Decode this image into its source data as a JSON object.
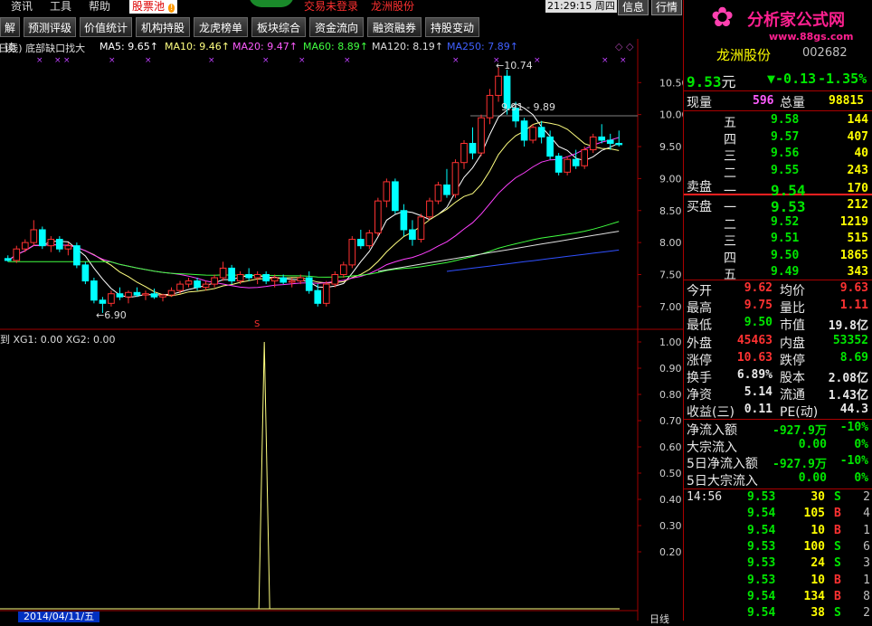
{
  "menu": {
    "items": [
      "资讯",
      "工具",
      "帮助"
    ],
    "pool_tab": "股票池",
    "notice_left": "交易未登录",
    "notice_right": "龙洲股份",
    "clock": "21:29:15 周四",
    "btn_info": "信息",
    "btn_quote": "行情"
  },
  "toolbar": [
    "解读",
    "预测评级",
    "价值统计",
    "机构持股",
    "龙虎榜单",
    "板块综合",
    "资金流向",
    "融资融券",
    "持股变动"
  ],
  "chart_header": {
    "title": "(日线) 底部缺口找大",
    "ma5": "MA5: 9.65↑",
    "ma10": "MA10: 9.46↑",
    "ma20": "MA20: 9.47↑",
    "ma60": "MA60: 8.89↑",
    "ma120": "MA120: 8.19↑",
    "ma250": "MA250: 7.89↑"
  },
  "price_axis": [
    "10.50",
    "10.00",
    "9.50",
    "9.00",
    "8.50",
    "8.00",
    "7.50",
    "7.00"
  ],
  "price_annotations": {
    "high": "10.74",
    "low": "6.90",
    "range": "9.91 - 9.89",
    "marker": "S"
  },
  "indicator_header": "XG1: 0.00  XG2: 0.00",
  "indicator_axis": [
    "1.00",
    "0.90",
    "0.80",
    "0.70",
    "0.60",
    "0.50",
    "0.40",
    "0.30",
    "0.20"
  ],
  "bottom": {
    "date": "2014/04/11/五",
    "period": "日线"
  },
  "logo": {
    "name": "分析家公式网",
    "url": "www.88gs.com"
  },
  "stock": {
    "name": "龙洲股份",
    "code": "002682",
    "price": "9.53",
    "price_unit": "元",
    "change": "▼-0.13",
    "change_pct": "-1.35%"
  },
  "volume": {
    "now_label": "现量",
    "now": "596",
    "total_label": "总量",
    "total": "98815"
  },
  "sell_label": "卖盘",
  "buy_label": "买盘",
  "sell": [
    {
      "level": "五",
      "price": "9.58",
      "vol": "144"
    },
    {
      "level": "四",
      "price": "9.57",
      "vol": "407"
    },
    {
      "level": "三",
      "price": "9.56",
      "vol": "40"
    },
    {
      "level": "二",
      "price": "9.55",
      "vol": "243"
    },
    {
      "level": "一",
      "price": "9.54",
      "vol": "170"
    }
  ],
  "buy": [
    {
      "level": "一",
      "price": "9.53",
      "vol": "212"
    },
    {
      "level": "二",
      "price": "9.52",
      "vol": "1219"
    },
    {
      "level": "三",
      "price": "9.51",
      "vol": "515"
    },
    {
      "level": "四",
      "price": "9.50",
      "vol": "1865"
    },
    {
      "level": "五",
      "price": "9.49",
      "vol": "343"
    }
  ],
  "stats": [
    {
      "l1": "今开",
      "v1": "9.62",
      "c1": "red",
      "l2": "均价",
      "v2": "9.63",
      "c2": "red"
    },
    {
      "l1": "最高",
      "v1": "9.75",
      "c1": "red",
      "l2": "量比",
      "v2": "1.11",
      "c2": "red"
    },
    {
      "l1": "最低",
      "v1": "9.50",
      "c1": "green",
      "l2": "市值",
      "v2": "19.8亿",
      "c2": "white"
    },
    {
      "l1": "外盘",
      "v1": "45463",
      "c1": "red",
      "l2": "内盘",
      "v2": "53352",
      "c2": "green"
    },
    {
      "l1": "涨停",
      "v1": "10.63",
      "c1": "red",
      "l2": "跌停",
      "v2": "8.69",
      "c2": "green"
    },
    {
      "l1": "换手",
      "v1": "6.89%",
      "c1": "white",
      "l2": "股本",
      "v2": "2.08亿",
      "c2": "white"
    },
    {
      "l1": "净资",
      "v1": "5.14",
      "c1": "white",
      "l2": "流通",
      "v2": "1.43亿",
      "c2": "white"
    },
    {
      "l1": "收益(三)",
      "v1": "0.11",
      "c1": "white",
      "l2": "PE(动)",
      "v2": "44.3",
      "c2": "white"
    }
  ],
  "flows": [
    {
      "label": "净流入额",
      "value": "-927.9万",
      "pct": "-10%",
      "c": "green"
    },
    {
      "label": "大宗流入",
      "value": "0.00",
      "pct": "0%",
      "c": "green"
    },
    {
      "label": "5日净流入额",
      "value": "-927.9万",
      "pct": "-10%",
      "c": "green"
    },
    {
      "label": "5日大宗流入",
      "value": "0.00",
      "pct": "0%",
      "c": "green"
    }
  ],
  "ticks": [
    {
      "time": "14:56",
      "price": "9.53",
      "vol": "30",
      "side": "S",
      "n": "2"
    },
    {
      "time": "",
      "price": "9.54",
      "vol": "105",
      "side": "B",
      "n": "4"
    },
    {
      "time": "",
      "price": "9.54",
      "vol": "10",
      "side": "B",
      "n": "1"
    },
    {
      "time": "",
      "price": "9.53",
      "vol": "100",
      "side": "S",
      "n": "6"
    },
    {
      "time": "",
      "price": "9.53",
      "vol": "24",
      "side": "S",
      "n": "3"
    },
    {
      "time": "",
      "price": "9.53",
      "vol": "10",
      "side": "B",
      "n": "1"
    },
    {
      "time": "",
      "price": "9.54",
      "vol": "134",
      "side": "B",
      "n": "8"
    },
    {
      "time": "",
      "price": "9.54",
      "vol": "38",
      "side": "S",
      "n": "2"
    }
  ],
  "chart_data": {
    "type": "candlestick",
    "ylim": [
      6.8,
      10.9
    ],
    "xg1_spike_index": 30,
    "candles": [
      [
        7.75,
        7.8,
        7.7,
        7.72
      ],
      [
        7.72,
        7.95,
        7.68,
        7.9
      ],
      [
        7.9,
        8.05,
        7.85,
        8.0
      ],
      [
        8.0,
        8.35,
        7.95,
        8.2
      ],
      [
        8.2,
        8.25,
        7.9,
        7.95
      ],
      [
        7.95,
        8.1,
        7.85,
        8.05
      ],
      [
        8.05,
        8.1,
        7.85,
        7.9
      ],
      [
        7.9,
        8.0,
        7.8,
        7.95
      ],
      [
        7.95,
        8.0,
        7.6,
        7.65
      ],
      [
        7.65,
        7.7,
        7.35,
        7.4
      ],
      [
        7.4,
        7.45,
        7.05,
        7.1
      ],
      [
        7.1,
        7.15,
        6.9,
        7.05
      ],
      [
        7.05,
        7.25,
        7.0,
        7.2
      ],
      [
        7.2,
        7.3,
        7.1,
        7.15
      ],
      [
        7.15,
        7.25,
        7.05,
        7.22
      ],
      [
        7.22,
        7.3,
        7.15,
        7.18
      ],
      [
        7.18,
        7.25,
        7.1,
        7.2
      ],
      [
        7.2,
        7.28,
        7.12,
        7.15
      ],
      [
        7.15,
        7.2,
        7.08,
        7.18
      ],
      [
        7.18,
        7.3,
        7.15,
        7.25
      ],
      [
        7.25,
        7.4,
        7.2,
        7.35
      ],
      [
        7.35,
        7.45,
        7.3,
        7.4
      ],
      [
        7.4,
        7.45,
        7.25,
        7.3
      ],
      [
        7.3,
        7.4,
        7.25,
        7.35
      ],
      [
        7.35,
        7.5,
        7.3,
        7.45
      ],
      [
        7.45,
        7.7,
        7.4,
        7.6
      ],
      [
        7.6,
        7.65,
        7.35,
        7.4
      ],
      [
        7.4,
        7.55,
        7.35,
        7.5
      ],
      [
        7.5,
        7.6,
        7.4,
        7.45
      ],
      [
        7.45,
        7.55,
        7.35,
        7.5
      ],
      [
        7.5,
        7.55,
        7.35,
        7.4
      ],
      [
        7.4,
        7.5,
        7.3,
        7.45
      ],
      [
        7.45,
        7.5,
        7.35,
        7.38
      ],
      [
        7.38,
        7.45,
        7.3,
        7.4
      ],
      [
        7.4,
        7.5,
        7.35,
        7.45
      ],
      [
        7.45,
        7.55,
        7.2,
        7.25
      ],
      [
        7.25,
        7.35,
        7.0,
        7.05
      ],
      [
        7.05,
        7.4,
        7.0,
        7.35
      ],
      [
        7.35,
        7.55,
        7.3,
        7.5
      ],
      [
        7.5,
        7.7,
        7.45,
        7.65
      ],
      [
        7.65,
        8.1,
        7.6,
        8.05
      ],
      [
        8.05,
        8.2,
        7.9,
        7.95
      ],
      [
        7.95,
        8.2,
        7.9,
        8.15
      ],
      [
        8.15,
        8.7,
        8.1,
        8.65
      ],
      [
        8.65,
        9.0,
        8.55,
        8.95
      ],
      [
        8.95,
        9.0,
        8.45,
        8.5
      ],
      [
        8.5,
        8.6,
        8.1,
        8.2
      ],
      [
        8.2,
        8.35,
        7.95,
        8.05
      ],
      [
        8.05,
        8.45,
        8.0,
        8.4
      ],
      [
        8.4,
        8.7,
        8.35,
        8.65
      ],
      [
        8.65,
        8.95,
        8.6,
        8.9
      ],
      [
        8.9,
        9.15,
        8.7,
        8.75
      ],
      [
        8.75,
        9.3,
        8.7,
        9.25
      ],
      [
        9.25,
        9.6,
        9.15,
        9.55
      ],
      [
        9.55,
        9.8,
        9.3,
        9.4
      ],
      [
        9.4,
        10.0,
        9.35,
        9.95
      ],
      [
        9.95,
        10.4,
        9.85,
        10.3
      ],
      [
        10.3,
        10.74,
        10.2,
        10.6
      ],
      [
        10.6,
        10.7,
        10.0,
        10.1
      ],
      [
        10.1,
        10.2,
        9.8,
        9.9
      ],
      [
        9.9,
        9.95,
        9.5,
        9.6
      ],
      [
        9.6,
        9.85,
        9.55,
        9.8
      ],
      [
        9.8,
        9.9,
        9.55,
        9.65
      ],
      [
        9.65,
        9.75,
        9.3,
        9.35
      ],
      [
        9.35,
        9.4,
        9.05,
        9.1
      ],
      [
        9.1,
        9.35,
        9.05,
        9.3
      ],
      [
        9.3,
        9.45,
        9.15,
        9.2
      ],
      [
        9.2,
        9.5,
        9.15,
        9.45
      ],
      [
        9.45,
        9.7,
        9.4,
        9.65
      ],
      [
        9.65,
        9.85,
        9.55,
        9.6
      ],
      [
        9.6,
        9.7,
        9.45,
        9.55
      ],
      [
        9.55,
        9.75,
        9.5,
        9.53
      ]
    ]
  }
}
